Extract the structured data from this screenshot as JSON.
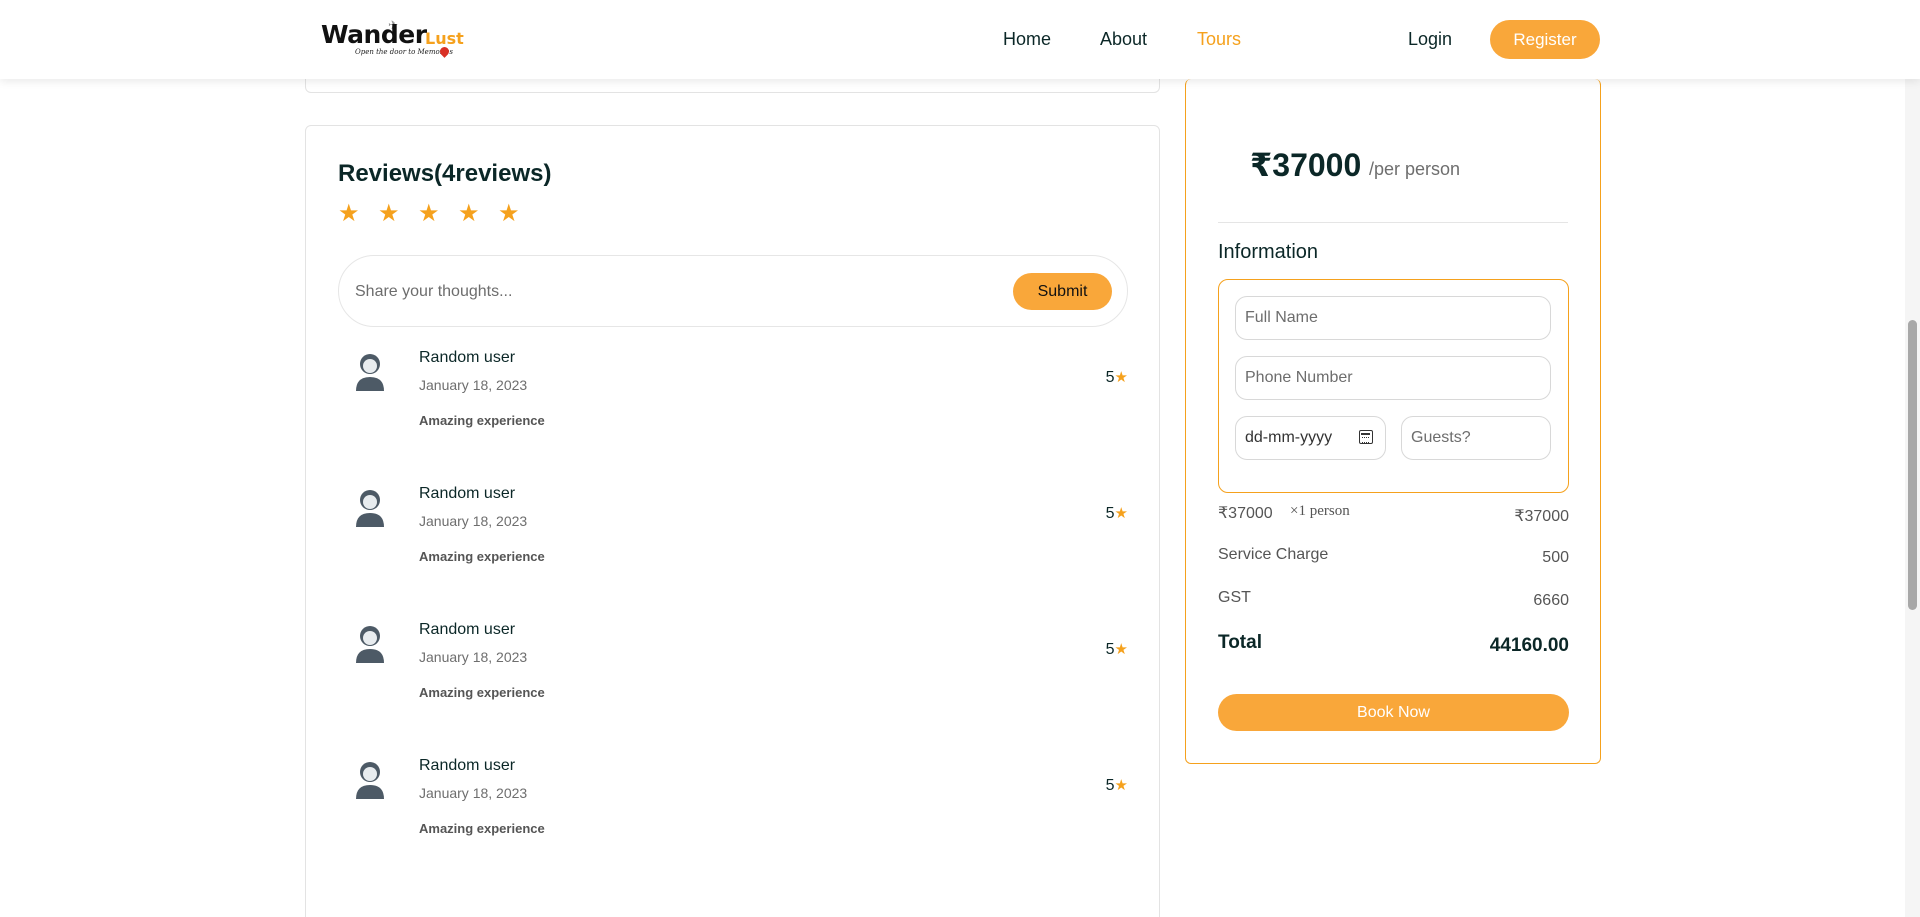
{
  "header": {
    "logo": {
      "main": "Wander",
      "sub": "Lust",
      "tagline": "Open the door to Memories"
    },
    "nav": [
      {
        "label": "Home",
        "active": false
      },
      {
        "label": "About",
        "active": false
      },
      {
        "label": "Tours",
        "active": true
      }
    ],
    "login_label": "Login",
    "register_label": "Register"
  },
  "reviews": {
    "title": "Reviews(4reviews)",
    "star_count": 5,
    "input_placeholder": "Share your thoughts...",
    "submit_label": "Submit",
    "items": [
      {
        "name": "Random user",
        "date": "January 18, 2023",
        "text": "Amazing experience",
        "rating": "5"
      },
      {
        "name": "Random user",
        "date": "January 18, 2023",
        "text": "Amazing experience",
        "rating": "5"
      },
      {
        "name": "Random user",
        "date": "January 18, 2023",
        "text": "Amazing experience",
        "rating": "5"
      },
      {
        "name": "Random user",
        "date": "January 18, 2023",
        "text": "Amazing experience",
        "rating": "5"
      }
    ]
  },
  "booking": {
    "price": "₹37000",
    "per": "/per person",
    "info_title": "Information",
    "fullname_placeholder": "Full Name",
    "phone_placeholder": "Phone Number",
    "date_value": "dd-mm-yyyy",
    "guests_placeholder": "Guests?",
    "line_price": "₹37000",
    "line_multiplier": "1 person",
    "line_total": "₹37000",
    "service_label": "Service Charge",
    "service_value": "500",
    "gst_label": "GST",
    "gst_value": "6660",
    "total_label": "Total",
    "total_value": "44160.00",
    "book_label": "Book Now"
  },
  "colors": {
    "accent": "#f9a73a",
    "heading": "#0b2727"
  }
}
